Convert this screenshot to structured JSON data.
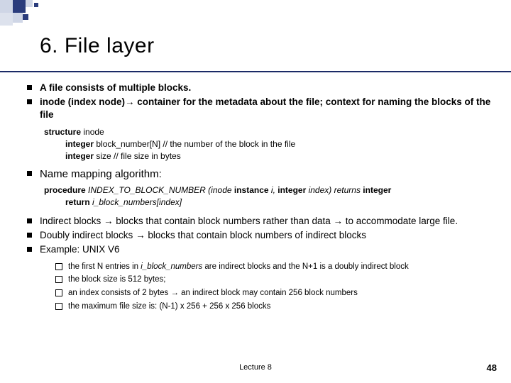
{
  "title": "6. File layer",
  "bullets": {
    "b1": "A file consists of multiple blocks.",
    "b2_pre": "inode (index node)",
    "b2_post": " container for the metadata about the file; context for naming the blocks of the file",
    "b3": "Name mapping algorithm:",
    "b4_a": "Indirect blocks ",
    "b4_b": " blocks that contain block numbers rather than data ",
    "b4_c": " to accommodate large file.",
    "b5_a": "Doubly indirect blocks ",
    "b5_b": " blocks that contain block numbers of indirect blocks",
    "b6": "Example: UNIX V6"
  },
  "struct": {
    "l1_kw": "structure",
    "l1_rest": " inode",
    "l2_kw": "integer",
    "l2_rest": "  block_number[N]   // the number of the block in the file",
    "l3_kw": "integer",
    "l3_rest": " size      // file size in bytes"
  },
  "proc": {
    "l1a": "procedure",
    "l1b": " INDEX_TO_BLOCK_NUMBER (inode ",
    "l1c": "instance",
    "l1d": " i, ",
    "l1e": "integer",
    "l1f": " index) returns ",
    "l1g": "integer",
    "l2a": "return",
    "l2b": " i_block_numbers[index]"
  },
  "subs": {
    "s1a": "the first N entries in  ",
    "s1b": "i_block_numbers",
    "s1c": " are indirect blocks and the N+1 is a doubly indirect block",
    "s2": "the block size is 512 bytes;",
    "s3a": "an index consists of 2 bytes ",
    "s3b": " an indirect block may contain 256 block numbers",
    "s4": "the maximum file size is: (N-1) x 256 + 256 x 256 blocks"
  },
  "arrow": "→",
  "footer": "Lecture 8",
  "page": "48"
}
